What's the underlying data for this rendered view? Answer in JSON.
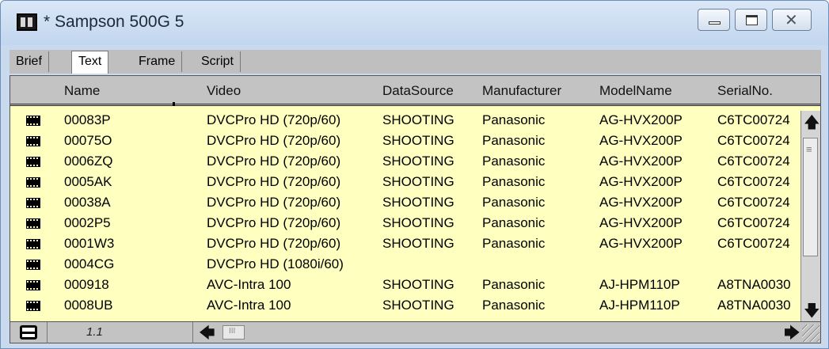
{
  "window": {
    "title": "* Sampson 500G 5",
    "icon": "film-bin-icon"
  },
  "tabs": [
    {
      "label": "Brief",
      "active": false
    },
    {
      "label": "Text",
      "active": true
    },
    {
      "label": "Frame",
      "active": false
    },
    {
      "label": "Script",
      "active": false
    }
  ],
  "table": {
    "columns": [
      "Name",
      "Video",
      "DataSource",
      "Manufacturer",
      "ModelName",
      "SerialNo."
    ],
    "rows": [
      {
        "name": "00083P",
        "video": "DVCPro HD (720p/60)",
        "datasource": "SHOOTING",
        "manufacturer": "Panasonic",
        "model": "AG-HVX200P",
        "serial": "C6TC00724"
      },
      {
        "name": "00075O",
        "video": "DVCPro HD (720p/60)",
        "datasource": "SHOOTING",
        "manufacturer": "Panasonic",
        "model": "AG-HVX200P",
        "serial": "C6TC00724"
      },
      {
        "name": "0006ZQ",
        "video": "DVCPro HD (720p/60)",
        "datasource": "SHOOTING",
        "manufacturer": "Panasonic",
        "model": "AG-HVX200P",
        "serial": "C6TC00724"
      },
      {
        "name": "0005AK",
        "video": "DVCPro HD (720p/60)",
        "datasource": "SHOOTING",
        "manufacturer": "Panasonic",
        "model": "AG-HVX200P",
        "serial": "C6TC00724"
      },
      {
        "name": "00038A",
        "video": "DVCPro HD (720p/60)",
        "datasource": "SHOOTING",
        "manufacturer": "Panasonic",
        "model": "AG-HVX200P",
        "serial": "C6TC00724"
      },
      {
        "name": "0002P5",
        "video": "DVCPro HD (720p/60)",
        "datasource": "SHOOTING",
        "manufacturer": "Panasonic",
        "model": "AG-HVX200P",
        "serial": "C6TC00724"
      },
      {
        "name": "0001W3",
        "video": "DVCPro HD (720p/60)",
        "datasource": "SHOOTING",
        "manufacturer": "Panasonic",
        "model": "AG-HVX200P",
        "serial": "C6TC00724"
      },
      {
        "name": "0004CG",
        "video": "DVCPro HD (1080i/60)",
        "datasource": "",
        "manufacturer": "",
        "model": "",
        "serial": ""
      },
      {
        "name": "000918",
        "video": "AVC-Intra 100",
        "datasource": "SHOOTING",
        "manufacturer": "Panasonic",
        "model": "AJ-HPM110P",
        "serial": "A8TNA0030"
      },
      {
        "name": "0008UB",
        "video": "AVC-Intra 100",
        "datasource": "SHOOTING",
        "manufacturer": "Panasonic",
        "model": "AJ-HPM110P",
        "serial": "A8TNA0030"
      }
    ]
  },
  "status": {
    "index": "1.1"
  },
  "colors": {
    "row_background": "#ffffc0",
    "header_background": "#c3c3c3",
    "titlebar": "#c9d9ee"
  }
}
